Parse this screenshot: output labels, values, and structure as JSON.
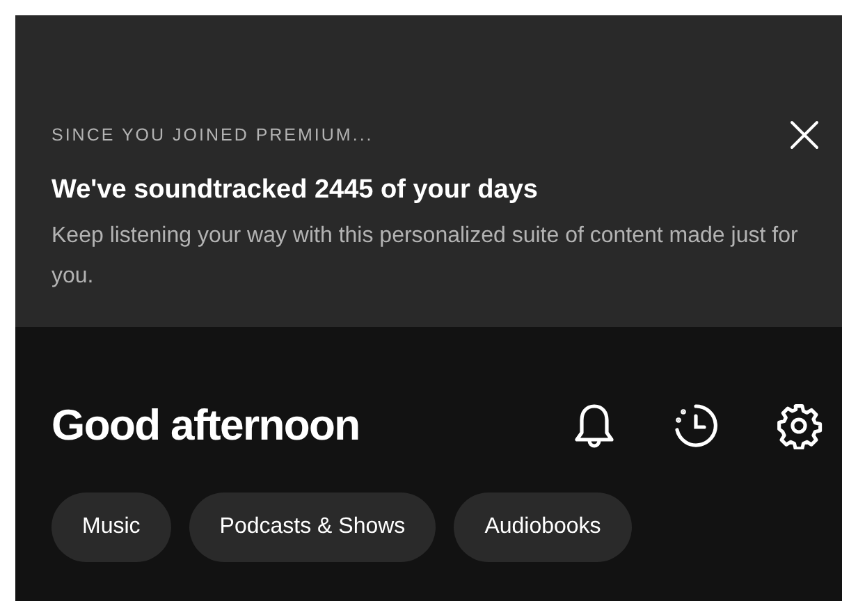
{
  "banner": {
    "eyebrow": "SINCE YOU JOINED PREMIUM...",
    "title": "We've soundtracked 2445 of your days",
    "body": "Keep listening your way with this personalized suite of content made just for you."
  },
  "header": {
    "greeting": "Good afternoon"
  },
  "filters": [
    {
      "label": "Music",
      "selected": false
    },
    {
      "label": "Podcasts & Shows",
      "selected": false
    },
    {
      "label": "Audiobooks",
      "selected": false
    }
  ]
}
